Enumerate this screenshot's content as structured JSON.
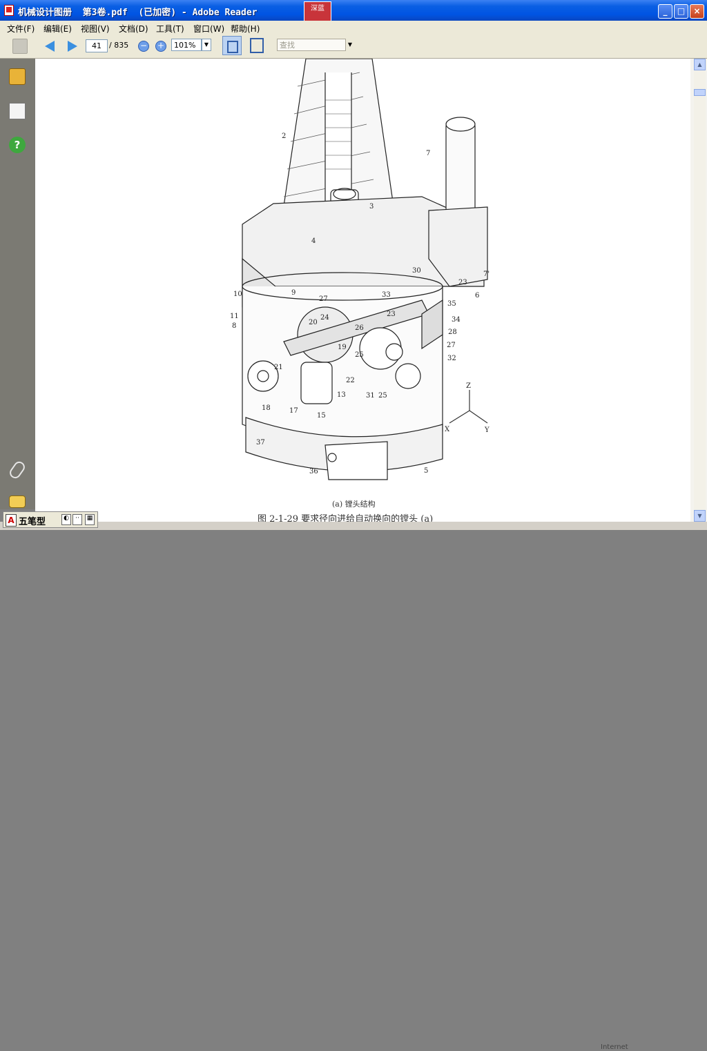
{
  "window": {
    "title": "机械设计图册  第3卷.pdf  (已加密) - Adobe Reader",
    "badge": "深蓝"
  },
  "menu": [
    "文件(F)",
    "编辑(E)",
    "视图(V)",
    "文档(D)",
    "工具(T)",
    "窗口(W)",
    "帮助(H)"
  ],
  "toolbar": {
    "page_current": "41",
    "page_total": "/ 835",
    "zoom": "101%",
    "search_placeholder": "查找"
  },
  "drawing": {
    "labels": [
      "2",
      "7",
      "3",
      "4",
      "7'",
      "30",
      "23",
      "6",
      "10",
      "9",
      "11",
      "27",
      "35",
      "33",
      "24",
      "23",
      "34",
      "8",
      "20",
      "26",
      "28",
      "19",
      "27",
      "25",
      "32",
      "21",
      "22",
      "13",
      "31",
      "25",
      "17",
      "15",
      "18",
      "37",
      "36",
      "5",
      "Z",
      "X",
      "Y"
    ]
  },
  "captions": {
    "sub": "(a) 镗头结构",
    "figure": "图 2-1-29  要求径向进给自动换向的镗头 (a)"
  },
  "ime": {
    "mode_letter": "A",
    "name": "五笔型"
  },
  "status": {
    "zone": "Internet"
  }
}
